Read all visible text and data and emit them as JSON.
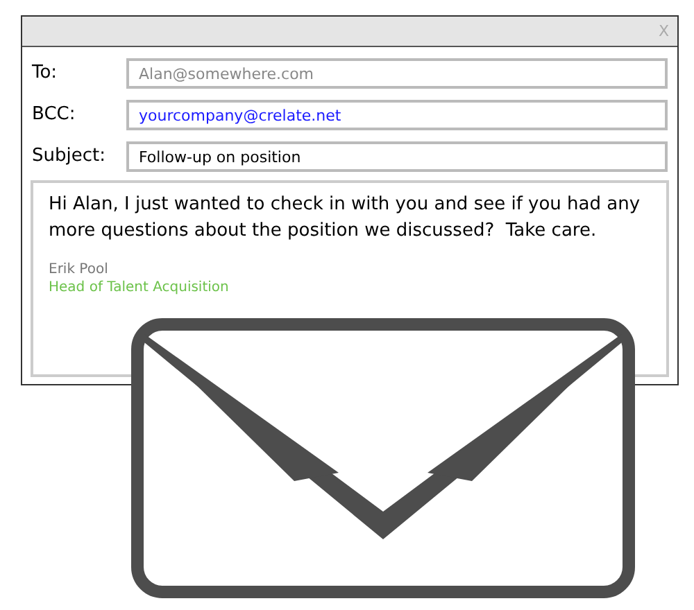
{
  "window": {
    "close": "X"
  },
  "fields": [
    {
      "label": "To:",
      "placeholder": "Alan@somewhere.com"
    },
    {
      "label": "BCC:",
      "value": "yourcompany@crelate.net"
    },
    {
      "label": "Subject:",
      "value": "Follow-up on position"
    }
  ],
  "message": {
    "body": "Hi Alan, I just wanted to check in with you and see if you had any more questions about the position we discussed?  Take care.",
    "signature_name": "Erik Pool",
    "signature_title": "Head of Talent Acquisition"
  }
}
